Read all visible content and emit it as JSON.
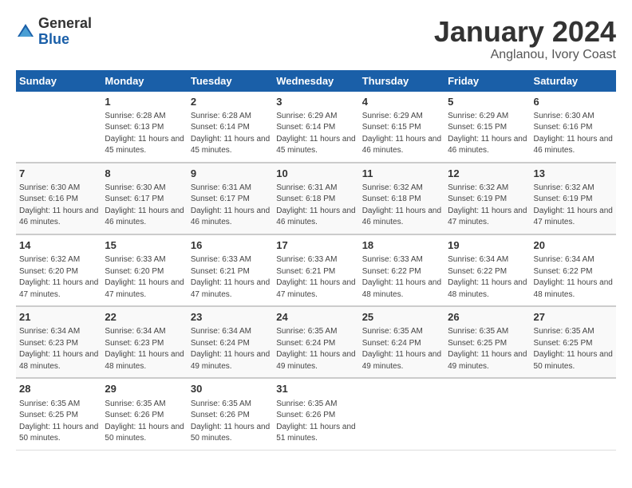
{
  "logo": {
    "general": "General",
    "blue": "Blue"
  },
  "title": "January 2024",
  "location": "Anglanou, Ivory Coast",
  "days_header": [
    "Sunday",
    "Monday",
    "Tuesday",
    "Wednesday",
    "Thursday",
    "Friday",
    "Saturday"
  ],
  "weeks": [
    [
      {
        "day": "",
        "info": ""
      },
      {
        "day": "1",
        "info": "Sunrise: 6:28 AM\nSunset: 6:13 PM\nDaylight: 11 hours and 45 minutes."
      },
      {
        "day": "2",
        "info": "Sunrise: 6:28 AM\nSunset: 6:14 PM\nDaylight: 11 hours and 45 minutes."
      },
      {
        "day": "3",
        "info": "Sunrise: 6:29 AM\nSunset: 6:14 PM\nDaylight: 11 hours and 45 minutes."
      },
      {
        "day": "4",
        "info": "Sunrise: 6:29 AM\nSunset: 6:15 PM\nDaylight: 11 hours and 46 minutes."
      },
      {
        "day": "5",
        "info": "Sunrise: 6:29 AM\nSunset: 6:15 PM\nDaylight: 11 hours and 46 minutes."
      },
      {
        "day": "6",
        "info": "Sunrise: 6:30 AM\nSunset: 6:16 PM\nDaylight: 11 hours and 46 minutes."
      }
    ],
    [
      {
        "day": "7",
        "info": "Sunrise: 6:30 AM\nSunset: 6:16 PM\nDaylight: 11 hours and 46 minutes."
      },
      {
        "day": "8",
        "info": "Sunrise: 6:30 AM\nSunset: 6:17 PM\nDaylight: 11 hours and 46 minutes."
      },
      {
        "day": "9",
        "info": "Sunrise: 6:31 AM\nSunset: 6:17 PM\nDaylight: 11 hours and 46 minutes."
      },
      {
        "day": "10",
        "info": "Sunrise: 6:31 AM\nSunset: 6:18 PM\nDaylight: 11 hours and 46 minutes."
      },
      {
        "day": "11",
        "info": "Sunrise: 6:32 AM\nSunset: 6:18 PM\nDaylight: 11 hours and 46 minutes."
      },
      {
        "day": "12",
        "info": "Sunrise: 6:32 AM\nSunset: 6:19 PM\nDaylight: 11 hours and 47 minutes."
      },
      {
        "day": "13",
        "info": "Sunrise: 6:32 AM\nSunset: 6:19 PM\nDaylight: 11 hours and 47 minutes."
      }
    ],
    [
      {
        "day": "14",
        "info": "Sunrise: 6:32 AM\nSunset: 6:20 PM\nDaylight: 11 hours and 47 minutes."
      },
      {
        "day": "15",
        "info": "Sunrise: 6:33 AM\nSunset: 6:20 PM\nDaylight: 11 hours and 47 minutes."
      },
      {
        "day": "16",
        "info": "Sunrise: 6:33 AM\nSunset: 6:21 PM\nDaylight: 11 hours and 47 minutes."
      },
      {
        "day": "17",
        "info": "Sunrise: 6:33 AM\nSunset: 6:21 PM\nDaylight: 11 hours and 47 minutes."
      },
      {
        "day": "18",
        "info": "Sunrise: 6:33 AM\nSunset: 6:22 PM\nDaylight: 11 hours and 48 minutes."
      },
      {
        "day": "19",
        "info": "Sunrise: 6:34 AM\nSunset: 6:22 PM\nDaylight: 11 hours and 48 minutes."
      },
      {
        "day": "20",
        "info": "Sunrise: 6:34 AM\nSunset: 6:22 PM\nDaylight: 11 hours and 48 minutes."
      }
    ],
    [
      {
        "day": "21",
        "info": "Sunrise: 6:34 AM\nSunset: 6:23 PM\nDaylight: 11 hours and 48 minutes."
      },
      {
        "day": "22",
        "info": "Sunrise: 6:34 AM\nSunset: 6:23 PM\nDaylight: 11 hours and 48 minutes."
      },
      {
        "day": "23",
        "info": "Sunrise: 6:34 AM\nSunset: 6:24 PM\nDaylight: 11 hours and 49 minutes."
      },
      {
        "day": "24",
        "info": "Sunrise: 6:35 AM\nSunset: 6:24 PM\nDaylight: 11 hours and 49 minutes."
      },
      {
        "day": "25",
        "info": "Sunrise: 6:35 AM\nSunset: 6:24 PM\nDaylight: 11 hours and 49 minutes."
      },
      {
        "day": "26",
        "info": "Sunrise: 6:35 AM\nSunset: 6:25 PM\nDaylight: 11 hours and 49 minutes."
      },
      {
        "day": "27",
        "info": "Sunrise: 6:35 AM\nSunset: 6:25 PM\nDaylight: 11 hours and 50 minutes."
      }
    ],
    [
      {
        "day": "28",
        "info": "Sunrise: 6:35 AM\nSunset: 6:25 PM\nDaylight: 11 hours and 50 minutes."
      },
      {
        "day": "29",
        "info": "Sunrise: 6:35 AM\nSunset: 6:26 PM\nDaylight: 11 hours and 50 minutes."
      },
      {
        "day": "30",
        "info": "Sunrise: 6:35 AM\nSunset: 6:26 PM\nDaylight: 11 hours and 50 minutes."
      },
      {
        "day": "31",
        "info": "Sunrise: 6:35 AM\nSunset: 6:26 PM\nDaylight: 11 hours and 51 minutes."
      },
      {
        "day": "",
        "info": ""
      },
      {
        "day": "",
        "info": ""
      },
      {
        "day": "",
        "info": ""
      }
    ]
  ]
}
